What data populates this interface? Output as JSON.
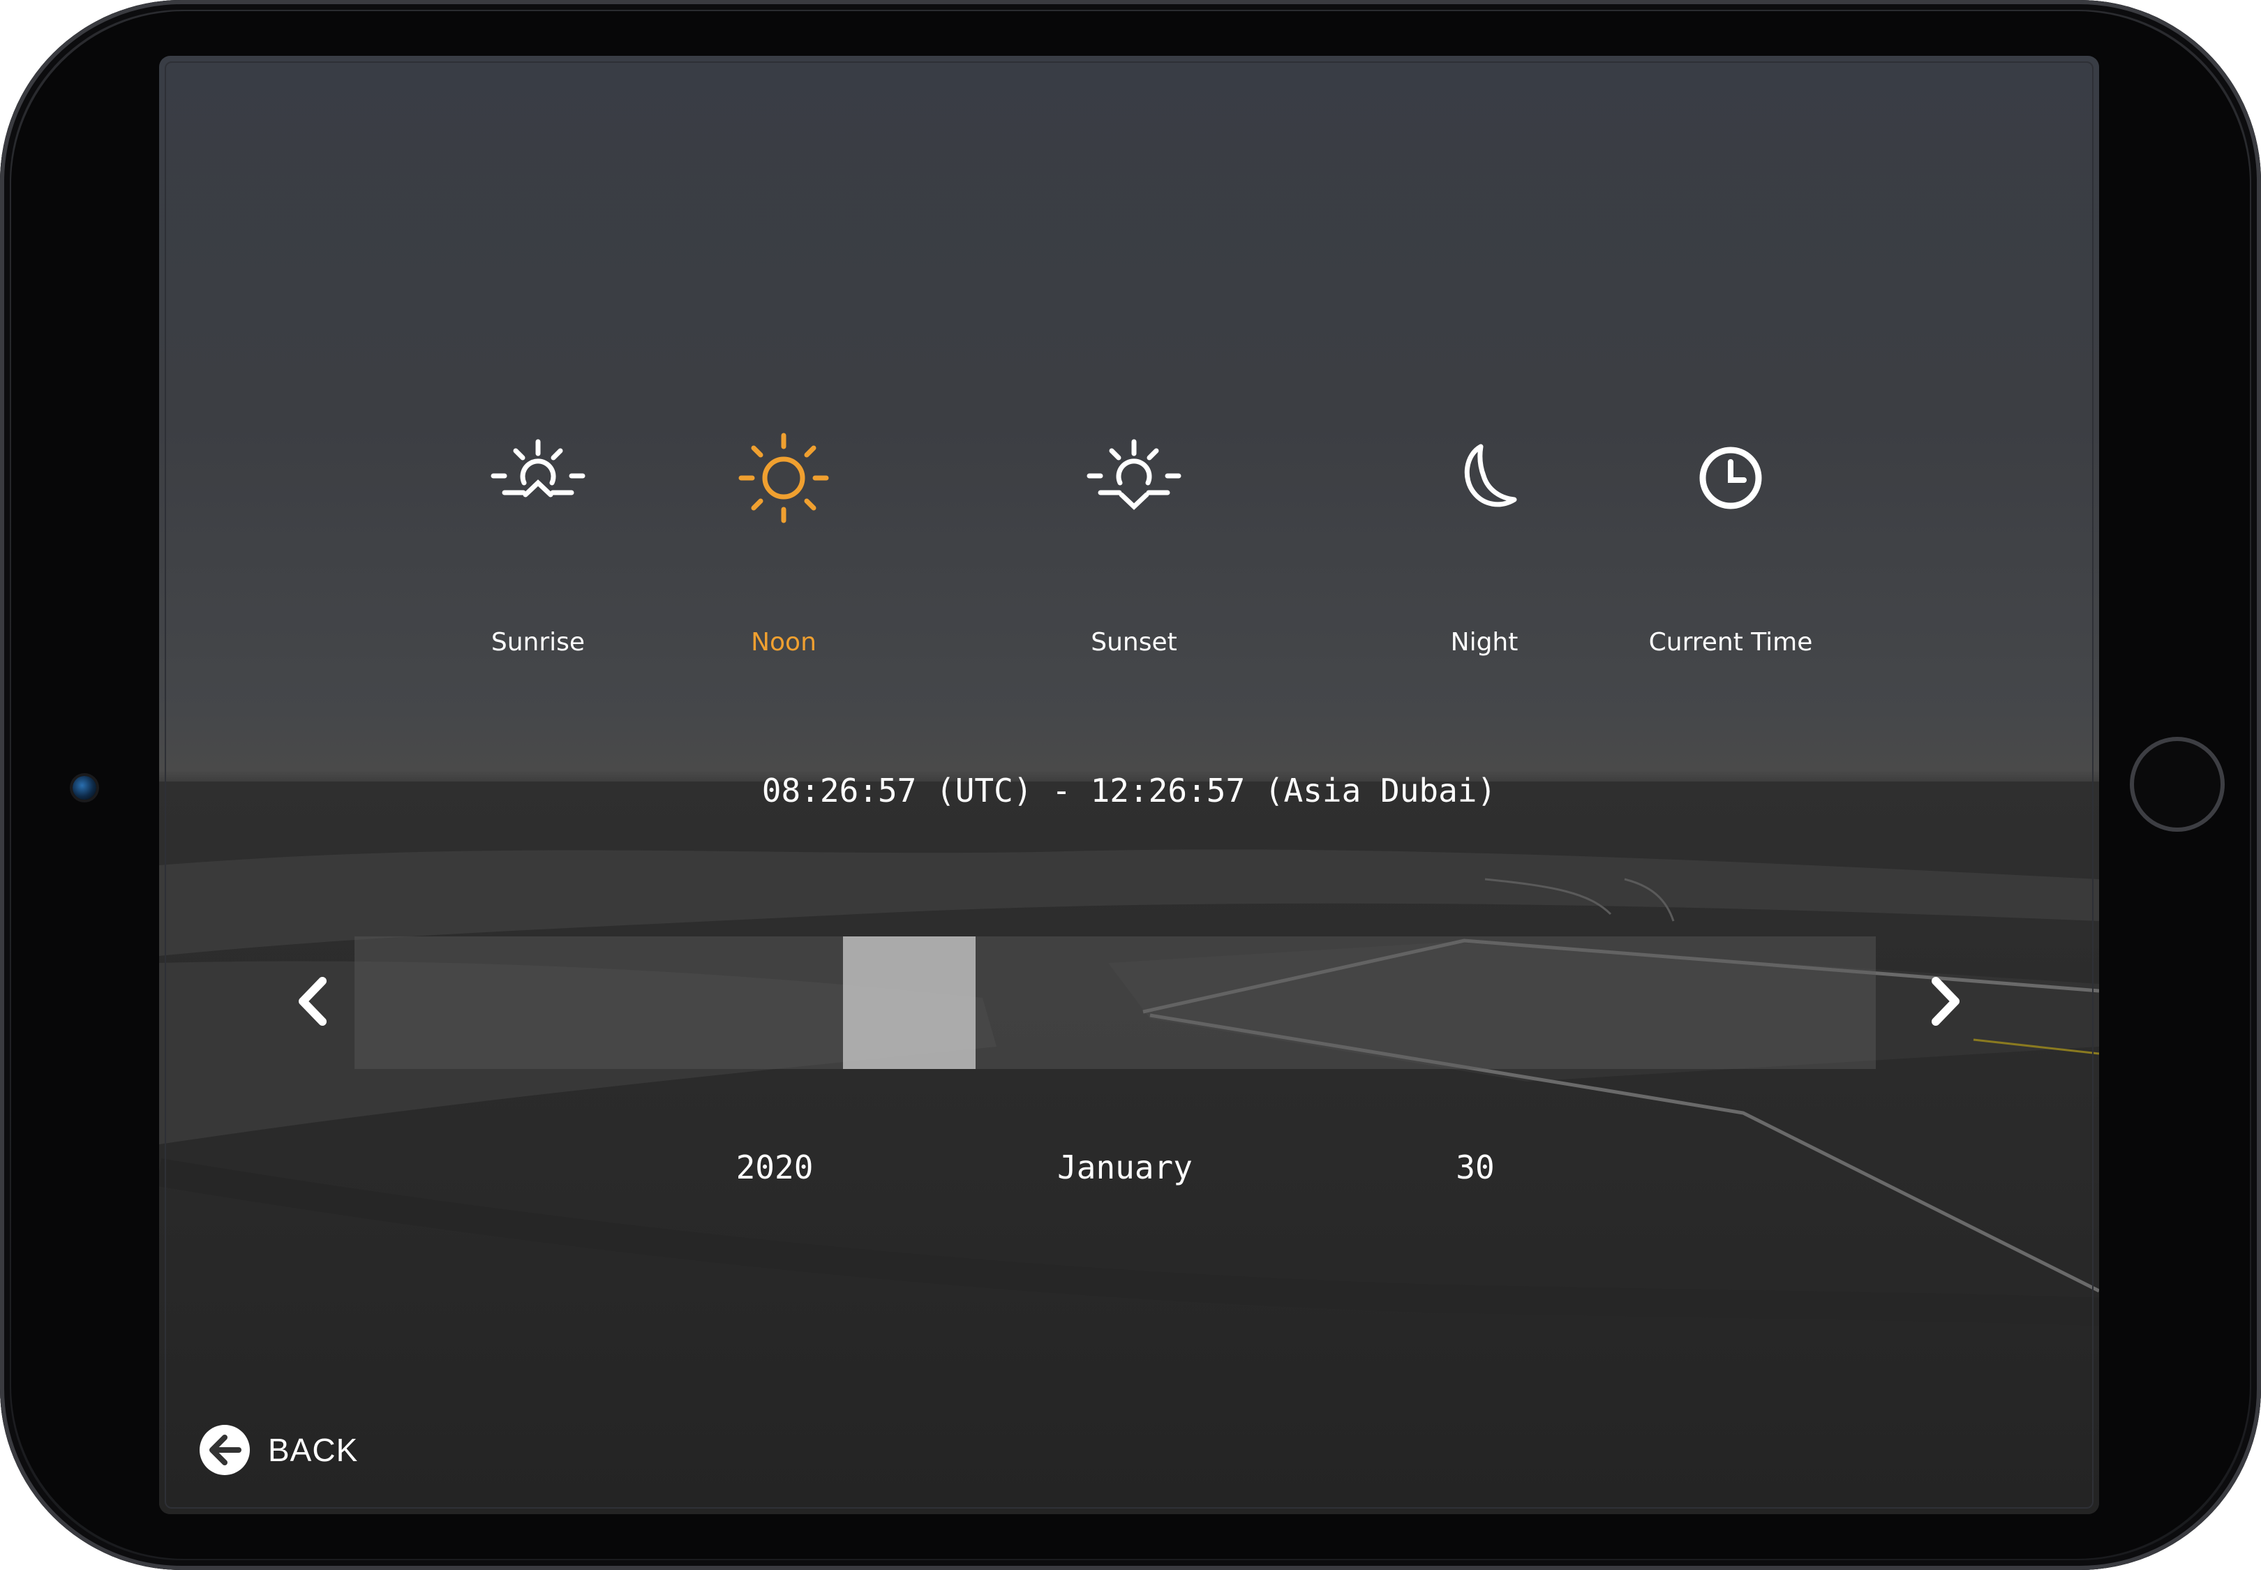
{
  "time_of_day": {
    "options": [
      {
        "label": "Sunrise",
        "icon": "sunrise-icon"
      },
      {
        "label": "Noon",
        "icon": "sun-icon"
      },
      {
        "label": "Sunset",
        "icon": "sunset-icon"
      },
      {
        "label": "Night",
        "icon": "moon-icon"
      },
      {
        "label": "Current Time",
        "icon": "clock-icon"
      }
    ],
    "selected": "Noon"
  },
  "time_readout": "08:26:57 (UTC) - 12:26:57 (Asia Dubai)",
  "date_picker": {
    "year": "2020",
    "month": "January",
    "day": "30",
    "prev_icon": "chevron-left-icon",
    "next_icon": "chevron-right-icon"
  },
  "back": {
    "label": "BACK",
    "icon": "back-arrow-icon"
  },
  "colors": {
    "accent": "#f0a030",
    "text": "#ffffff"
  }
}
